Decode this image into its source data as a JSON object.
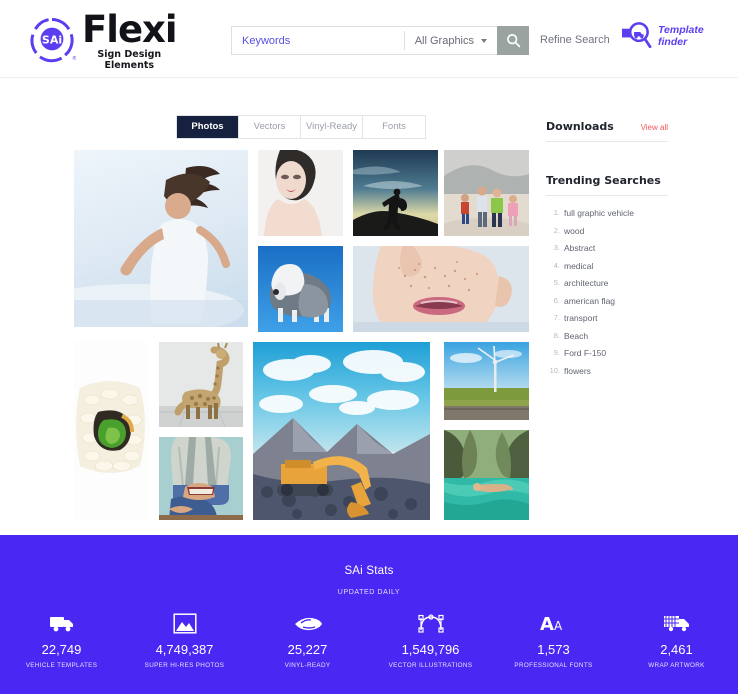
{
  "header": {
    "logo": {
      "badge_text": "SAi",
      "brand": "Flexi",
      "tagline_line1": "Sign Design",
      "tagline_line2": "Elements",
      "mark_icon": "sai-circular-logo-icon"
    },
    "search": {
      "placeholder": "Keywords",
      "value": "",
      "category_selected": "All Graphics",
      "search_icon": "search-icon",
      "dropdown_icon": "chevron-down-icon",
      "button_color": "#9aa3a0"
    },
    "refine_search": "Refine Search",
    "template_finder": {
      "line1": "Template",
      "line2": "finder",
      "icon": "magnifier-vehicle-icon"
    }
  },
  "main": {
    "tabs": [
      {
        "label": "Photos",
        "active": true
      },
      {
        "label": "Vectors",
        "active": false
      },
      {
        "label": "Vinyl-Ready",
        "active": false
      },
      {
        "label": "Fonts",
        "active": false
      }
    ],
    "gallery": [
      {
        "name": "woman-on-beach-hair-flip",
        "alt": "Woman flipping hair on sunny beach"
      },
      {
        "name": "fashion-portrait-woman",
        "alt": "Pale fashion beauty portrait"
      },
      {
        "name": "hiker-silhouette-sunset",
        "alt": "Silhouette of hiker at sunset"
      },
      {
        "name": "family-running-beach",
        "alt": "Family running on beach"
      },
      {
        "name": "sheepdog-on-blue",
        "alt": "Old English sheepdog on blue backdrop"
      },
      {
        "name": "freckled-face-closeup",
        "alt": "Close-up of freckled face and lips"
      },
      {
        "name": "sushi-roll-closeup",
        "alt": "Sushi roll close-up"
      },
      {
        "name": "giraffe-in-room",
        "alt": "Giraffe standing in white room"
      },
      {
        "name": "man-reading-book",
        "alt": "Man in plaid shirt reading a book"
      },
      {
        "name": "excavator-mountain",
        "alt": "Yellow excavator on mountain rubble"
      },
      {
        "name": "wind-turbine-field",
        "alt": "Wind turbine in green field"
      },
      {
        "name": "swimmer-in-lagoon",
        "alt": "Person floating in a green lagoon"
      }
    ]
  },
  "sidebar": {
    "downloads_title": "Downloads",
    "view_all": "View all",
    "trending_title": "Trending Searches",
    "trending": [
      "full graphic vehicle",
      "wood",
      "Abstract",
      "medical",
      "architecture",
      "american flag",
      "transport",
      "Beach",
      "Ford F-150",
      "flowers"
    ]
  },
  "stats": {
    "title": "SAi Stats",
    "subtitle": "UPDATED DAILY",
    "background": "#4a27f2",
    "items": [
      {
        "icon": "truck-icon",
        "value": "22,749",
        "label": "VEHICLE TEMPLATES"
      },
      {
        "icon": "photo-mountain-icon",
        "value": "4,749,387",
        "label": "SUPER HI-RES PHOTOS"
      },
      {
        "icon": "vinyl-cutter-icon",
        "value": "25,227",
        "label": "VINYL-READY"
      },
      {
        "icon": "bezier-curve-icon",
        "value": "1,549,796",
        "label": "VECTOR ILLUSTRATIONS"
      },
      {
        "icon": "font-aa-icon",
        "value": "1,573",
        "label": "PROFESSIONAL FONTS"
      },
      {
        "icon": "wrapped-truck-icon",
        "value": "2,461",
        "label": "WRAP ARTWORK"
      }
    ]
  }
}
